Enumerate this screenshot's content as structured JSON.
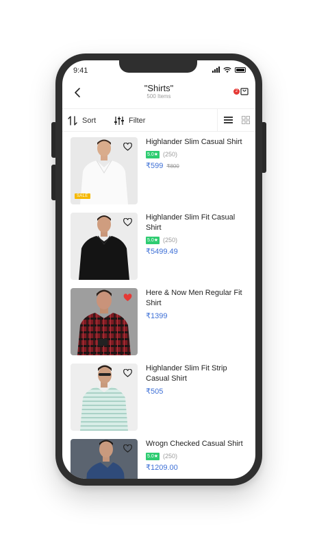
{
  "status": {
    "time": "9:41"
  },
  "header": {
    "title": "\"Shirts\"",
    "subtitle": "500 Items",
    "cart_count": "2"
  },
  "toolbar": {
    "sort_label": "Sort",
    "filter_label": "Filter"
  },
  "products": [
    {
      "name": "Highlander Slim Casual Shirt",
      "rating": "5.0★",
      "reviews": "(250)",
      "price": "₹599",
      "mrp": "₹800",
      "sale": "SALE",
      "liked": false
    },
    {
      "name": "Highlander Slim Fit Casual Shirt",
      "rating": "5.0★",
      "reviews": "(250)",
      "price": "₹5499.49",
      "liked": false
    },
    {
      "name": "Here & Now Men Regular Fit Shirt",
      "price": "₹1399",
      "liked": true
    },
    {
      "name": "Highlander Slim Fit Strip Casual Shirt",
      "price": "₹505",
      "liked": false
    },
    {
      "name": "Wrogn Checked Casual Shirt",
      "rating": "5.0★",
      "reviews": "(250)",
      "price": "₹1209.00",
      "liked": false
    }
  ],
  "colors": {
    "price": "#3d6fd6",
    "rating": "#2ecc71",
    "sale": "#f5b800",
    "heart_active": "#e53935"
  }
}
